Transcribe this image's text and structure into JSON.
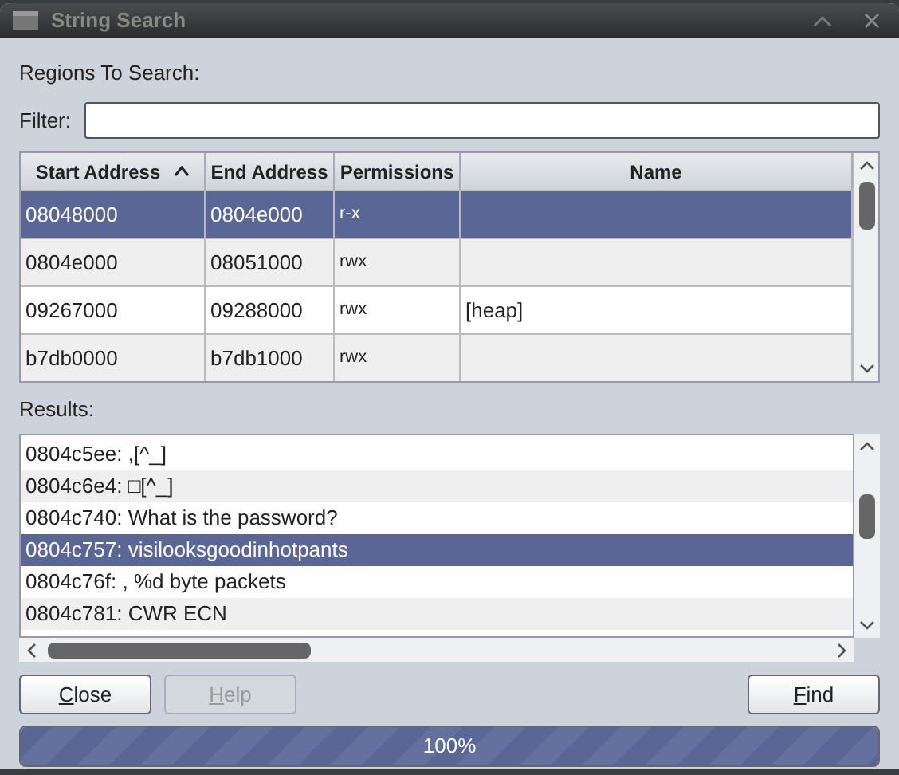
{
  "window": {
    "title": "String Search"
  },
  "regions_label": "Regions To Search:",
  "filter": {
    "label": "Filter:"
  },
  "table": {
    "columns": [
      {
        "label": "Start Address",
        "sorted": true
      },
      {
        "label": "End Address",
        "sorted": false
      },
      {
        "label": "Permissions",
        "sorted": false
      },
      {
        "label": "Name",
        "sorted": false
      }
    ],
    "rows": [
      {
        "cells": [
          "08048000",
          "0804e000",
          "r-x",
          ""
        ],
        "selected": true
      },
      {
        "cells": [
          "0804e000",
          "08051000",
          "rwx",
          ""
        ],
        "selected": false
      },
      {
        "cells": [
          "09267000",
          "09288000",
          "rwx",
          "[heap]"
        ],
        "selected": false
      },
      {
        "cells": [
          "b7db0000",
          "b7db1000",
          "rwx",
          ""
        ],
        "selected": false
      }
    ]
  },
  "results_label": "Results:",
  "results": [
    {
      "text": "0804c5ee: ,[^_]",
      "selected": false
    },
    {
      "text": "0804c6e4: □[^_]",
      "selected": false
    },
    {
      "text": "0804c740: What is the password?",
      "selected": false
    },
    {
      "text": "0804c757: visilooksgoodinhotpants",
      "selected": true
    },
    {
      "text": "0804c76f: , %d byte packets",
      "selected": false
    },
    {
      "text": "0804c781: CWR ECN",
      "selected": false
    }
  ],
  "buttons": [
    {
      "label": "Close",
      "disabled": false
    },
    {
      "label": "Help",
      "disabled": true
    },
    {
      "label": "Find",
      "disabled": false
    }
  ],
  "progress": {
    "level": 1,
    "reading": "100%"
  }
}
